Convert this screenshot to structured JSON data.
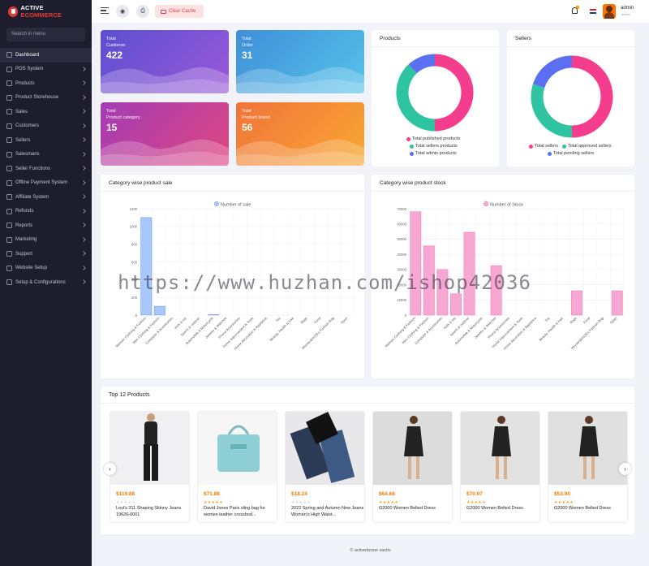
{
  "app": {
    "logo_prefix": "ACTIVE",
    "logo_suffix": "ECOMMERCE"
  },
  "sidebar": {
    "search_placeholder": "Search in menu",
    "items": [
      {
        "label": "Dashboard",
        "active": true
      },
      {
        "label": "POS System"
      },
      {
        "label": "Products"
      },
      {
        "label": "Product Storehouse"
      },
      {
        "label": "Sales"
      },
      {
        "label": "Customers"
      },
      {
        "label": "Sellers"
      },
      {
        "label": "Salesmans"
      },
      {
        "label": "Seller Functions"
      },
      {
        "label": "Offline Payment System"
      },
      {
        "label": "Affiliate System"
      },
      {
        "label": "Refunds"
      },
      {
        "label": "Reports"
      },
      {
        "label": "Marketing"
      },
      {
        "label": "Support"
      },
      {
        "label": "Website Setup"
      },
      {
        "label": "Setup & Configurations"
      }
    ]
  },
  "topbar": {
    "clear_cache": "Clear Cache",
    "user_name": "admin",
    "user_role": "admin"
  },
  "stats": [
    {
      "label1": "Total",
      "label2": "Customer",
      "value": "422",
      "color_a": "#5b4fd0",
      "color_b": "#9b59d8"
    },
    {
      "label1": "Total",
      "label2": "Order",
      "value": "31",
      "color_a": "#3f8ed8",
      "color_b": "#56c4ea"
    },
    {
      "label1": "Total",
      "label2": "Product category",
      "value": "15",
      "color_a": "#a23cb5",
      "color_b": "#e0477f"
    },
    {
      "label1": "Total",
      "label2": "Product brand",
      "value": "56",
      "color_a": "#f0743a",
      "color_b": "#f9a833"
    }
  ],
  "products_card": {
    "title": "Products",
    "legend": [
      "Total published products",
      "Total sellers products",
      "Total admin products"
    ]
  },
  "sellers_card": {
    "title": "Sellers",
    "legend": [
      "Total sellers",
      "Total approved sellers",
      "Total pending sellers"
    ]
  },
  "colors": {
    "pink": "#f53d8e",
    "teal": "#2ec4a2",
    "blue": "#5b6ff2",
    "bar_blue": "#a8c7fa",
    "bar_pink": "#f7a8d2"
  },
  "sale_card": {
    "title": "Category wise product sale"
  },
  "stock_card": {
    "title": "Category wise product stock"
  },
  "chart_data": [
    {
      "type": "pie",
      "title": "Products",
      "categories": [
        "Total published products",
        "Total sellers products",
        "Total admin products"
      ],
      "values": [
        50,
        38,
        12
      ]
    },
    {
      "type": "pie",
      "title": "Sellers",
      "categories": [
        "Total sellers",
        "Total approved sellers",
        "Total pending sellers"
      ],
      "values": [
        50,
        30,
        20
      ]
    },
    {
      "type": "bar",
      "title": "Category wise product sale",
      "series": [
        {
          "name": "Number of sale",
          "values": [
            1100,
            100,
            0,
            0,
            0,
            5,
            0,
            0,
            0,
            0,
            0,
            0,
            0,
            0,
            0,
            0
          ]
        }
      ],
      "categories": [
        "Women Clothing & Fashion",
        "Men Clothing & Fashion",
        "Computer & Accessories",
        "Kids & toy",
        "Sports & outdoor",
        "Automobile & Motorcycle",
        "Jewelry & Watches",
        "Phone Accessories",
        "Home Improvement & Tools",
        "Home decoration & Appliance",
        "Toy",
        "Beauty, Health & Hair",
        "Bags",
        "Food",
        "Women&#039;s Fashion Bag",
        "Sport"
      ],
      "ylim": [
        0,
        1200
      ],
      "yticks": [
        "0",
        "200",
        "400",
        "600",
        "800",
        "1000",
        "1200"
      ]
    },
    {
      "type": "bar",
      "title": "Category wise product stock",
      "series": [
        {
          "name": "Number of Stock",
          "values": [
            68000,
            45500,
            30000,
            14000,
            54500,
            0,
            32500,
            0,
            0,
            0,
            0,
            0,
            16000,
            0,
            0,
            16000
          ]
        }
      ],
      "categories": [
        "Women Clothing & Fashion",
        "Men Clothing & Fashion",
        "Computer & Accessories",
        "Kids & toy",
        "Sports & outdoor",
        "Automobile & Motorcycle",
        "Jewelry & Watches",
        "Phone Accessories",
        "Home Improvement & Tools",
        "Home decoration & Appliance",
        "Toy",
        "Beauty, Health & Hair",
        "Bags",
        "Food",
        "Women&#039;s Fashion Bag",
        "Sport"
      ],
      "ylim": [
        0,
        70000
      ],
      "yticks": [
        "0",
        "10000",
        "20000",
        "30000",
        "40000",
        "50000",
        "60000",
        "70000"
      ]
    }
  ],
  "top_products": {
    "title": "Top 12 Products",
    "items": [
      {
        "price": "$119.88",
        "stars": 0,
        "name": "Levi's 311 Shaping Skinny Jeans 19626-0001"
      },
      {
        "price": "$71.88",
        "stars": 5,
        "name": "David Jones Paris sling bag for women leather crossbod..."
      },
      {
        "price": "$18.24",
        "stars": 0,
        "name": "2022 Spring and Autumn New Jeans Women's High Waist..."
      },
      {
        "price": "$64.68",
        "stars": 5,
        "name": "G2000 Women Belted Dress"
      },
      {
        "price": "$70.07",
        "stars": 5,
        "name": "G2000 Women Belted Dress"
      },
      {
        "price": "$53.90",
        "stars": 5,
        "name": "G2000 Women Belted Dress"
      }
    ]
  },
  "footer": {
    "text": "© activeitzone vactiv"
  },
  "watermark": "https://www.huzhan.com/ishop42036"
}
